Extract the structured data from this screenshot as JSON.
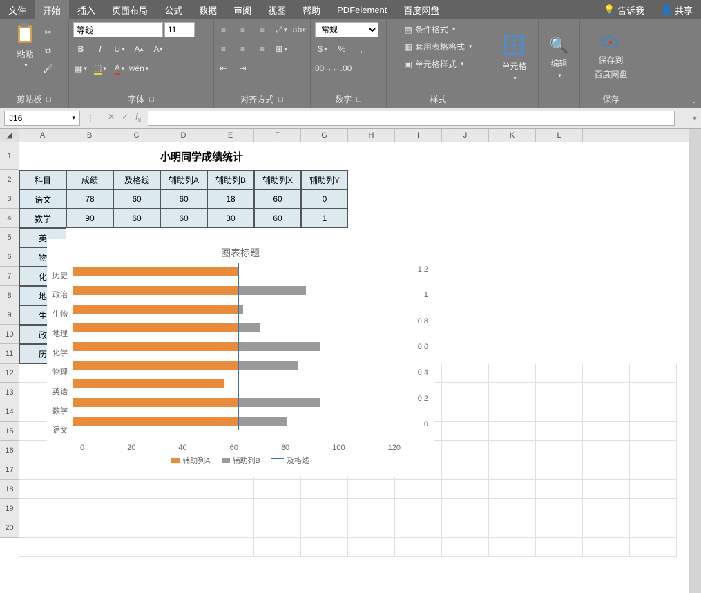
{
  "menu": {
    "file": "文件",
    "home": "开始",
    "insert": "插入",
    "layout": "页面布局",
    "formulas": "公式",
    "data": "数据",
    "review": "审阅",
    "view": "视图",
    "help": "帮助",
    "pdf": "PDFelement",
    "baidu": "百度网盘",
    "tellme": "告诉我",
    "share": "共享"
  },
  "ribbon": {
    "clipboard": {
      "paste": "粘贴",
      "label": "剪贴板"
    },
    "font": {
      "name": "等线",
      "size": "11",
      "label": "字体"
    },
    "align": {
      "label": "对齐方式"
    },
    "number": {
      "format": "常规",
      "label": "数字"
    },
    "styles": {
      "cond": "条件格式",
      "table": "套用表格格式",
      "cell": "单元格样式",
      "label": "样式"
    },
    "cells": {
      "label": "单元格"
    },
    "edit": {
      "label": "编辑"
    },
    "save": {
      "top": "保存到",
      "bottom": "百度网盘",
      "label": "保存"
    }
  },
  "namebox": "J16",
  "columns": [
    "A",
    "B",
    "C",
    "D",
    "E",
    "F",
    "G",
    "H",
    "I",
    "J",
    "K",
    "L"
  ],
  "rows": [
    "1",
    "2",
    "3",
    "4",
    "5",
    "6",
    "7",
    "8",
    "9",
    "10",
    "11",
    "12",
    "13",
    "14",
    "15",
    "16",
    "17",
    "18",
    "19",
    "20"
  ],
  "title": "小明同学成绩统计",
  "headers": [
    "科目",
    "成绩",
    "及格线",
    "辅助列A",
    "辅助列B",
    "辅助列X",
    "辅助列Y"
  ],
  "table": [
    [
      "语文",
      "78",
      "60",
      "60",
      "18",
      "60",
      "0"
    ],
    [
      "数学",
      "90",
      "60",
      "60",
      "30",
      "60",
      "1"
    ],
    [
      "英",
      "",
      "",
      "",
      "",
      "",
      ""
    ],
    [
      "物",
      "",
      "",
      "",
      "",
      "",
      ""
    ],
    [
      "化",
      "",
      "",
      "",
      "",
      "",
      ""
    ],
    [
      "地",
      "",
      "",
      "",
      "",
      "",
      ""
    ],
    [
      "生",
      "",
      "",
      "",
      "",
      "",
      ""
    ],
    [
      "政",
      "",
      "",
      "",
      "",
      "",
      ""
    ],
    [
      "历",
      "",
      "",
      "",
      "",
      "",
      ""
    ]
  ],
  "chart_data": {
    "type": "bar",
    "title": "图表标题",
    "categories": [
      "历史",
      "政治",
      "生物",
      "地理",
      "化学",
      "物理",
      "英语",
      "数学",
      "语文"
    ],
    "series": [
      {
        "name": "辅助列A",
        "values": [
          60,
          60,
          60,
          60,
          60,
          60,
          55,
          60,
          60
        ]
      },
      {
        "name": "辅助列B",
        "values": [
          0,
          25,
          2,
          8,
          30,
          22,
          0,
          30,
          18
        ]
      }
    ],
    "pass_line": {
      "name": "及格线",
      "x": 60
    },
    "xlim": [
      0,
      120
    ],
    "x_ticks": [
      "0",
      "20",
      "40",
      "60",
      "80",
      "100",
      "120"
    ],
    "secondary_axis": {
      "min": 0,
      "max": 1.2,
      "ticks": [
        "1.2",
        "1",
        "0.8",
        "0.6",
        "0.4",
        "0.2",
        "0"
      ]
    },
    "legend": [
      "辅助列A",
      "辅助列B",
      "及格线"
    ]
  }
}
